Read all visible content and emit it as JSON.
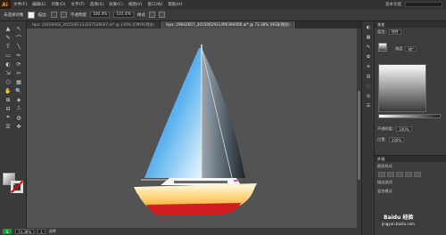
{
  "app": {
    "logo": "Ai"
  },
  "menu": {
    "items": [
      "文件(F)",
      "编辑(E)",
      "对象(O)",
      "文字(T)",
      "选择(S)",
      "效果(C)",
      "视图(V)",
      "窗口(W)",
      "帮助(H)"
    ],
    "workspace": "基本功能"
  },
  "control": {
    "label_none": "未选择对象",
    "stroke": "描边:",
    "fill_mode": "不透明度",
    "x_val": "100.4%",
    "y_val": "101.4%",
    "style": "样式"
  },
  "tabs": [
    {
      "label": "Hpx: 20160602_2015061113257528067.ai* @ 110% (CMYK/预览)",
      "active": false
    },
    {
      "label": "Hpx: 29642607_2015062911490390000.ai* @ 73.38% (RGB/预览)",
      "active": true
    }
  ],
  "tools": [
    "▲",
    "↖",
    "✎",
    "⌒",
    "T",
    "╲",
    "▭",
    "✏",
    "◐",
    "⟳",
    "⇲",
    "✂",
    "⬡",
    "▦",
    "✋",
    "🔍",
    "⊞",
    "◈",
    "⊟",
    "⎍",
    "⌗",
    "◍",
    "☰",
    "✥"
  ],
  "status": {
    "logo": "S",
    "zoom": "73.38%",
    "page": "1",
    "tool": "选择"
  },
  "gradient_panel": {
    "title": "渐变",
    "type_label": "类型:",
    "type_value": "线性",
    "angle_label": "角度",
    "angle_value": "90°",
    "opacity_label": "不透明度:",
    "opacity_value": "100%",
    "location_label": "位置:",
    "location_value": "100%"
  },
  "appearance_panel": {
    "title": "外观",
    "row1": "图形样式",
    "row2": "描边选项",
    "row3": "混合模式"
  },
  "watermark": {
    "text": "Baidu 经验",
    "sub": "jingyan.baidu.com"
  }
}
